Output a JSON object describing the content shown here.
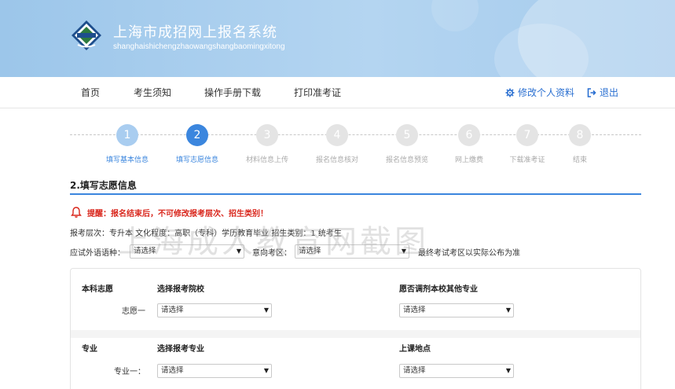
{
  "header": {
    "title": "上海市成招网上报名系统",
    "subtitle": "shanghaishichengzhaowangshangbaomingxitong"
  },
  "nav": {
    "items": [
      "首页",
      "考生须知",
      "操作手册下载",
      "打印准考证"
    ],
    "profile_label": "修改个人资料",
    "logout_label": "退出"
  },
  "steps": [
    {
      "num": "1",
      "label": "填写基本信息",
      "state": "done"
    },
    {
      "num": "2",
      "label": "填写志愿信息",
      "state": "active"
    },
    {
      "num": "3",
      "label": "材料信息上传",
      "state": "todo"
    },
    {
      "num": "4",
      "label": "报名信息核对",
      "state": "todo"
    },
    {
      "num": "5",
      "label": "报名信息预览",
      "state": "todo"
    },
    {
      "num": "6",
      "label": "网上缴费",
      "state": "todo"
    },
    {
      "num": "7",
      "label": "下载准考证",
      "state": "todo"
    },
    {
      "num": "8",
      "label": "结束",
      "state": "todo"
    }
  ],
  "section": {
    "title": "2.填写志愿信息",
    "warning": "提醒：报名结束后，不可修改报考层次、招生类别！",
    "info": "报考层次：专升本 文化程度：高职（专科）学历教育毕业 招生类别：1 统考生"
  },
  "exam": {
    "lang_label": "应试外语语种：",
    "lang_value": "请选择",
    "area_label": "意向考区：",
    "area_value": "请选择",
    "area_note": "最终考试考区以实际公布为准"
  },
  "watermark": "上海成人教育网截图",
  "card": {
    "row1": {
      "category": "本科志愿",
      "col_school": "选择报考院校",
      "col_adjust": "愿否调剂本校其他专业",
      "choice_label": "志愿一",
      "school_value": "请选择",
      "adjust_value": "请选择"
    },
    "row2": {
      "category": "专业",
      "col_major": "选择报考专业",
      "col_location": "上课地点",
      "choice_label": "专业一：",
      "major_value": "请选择",
      "location_value": "请选择"
    }
  },
  "colors": {
    "accent": "#3b86de",
    "warning": "#d9261c",
    "banner": "#a8cdee"
  }
}
